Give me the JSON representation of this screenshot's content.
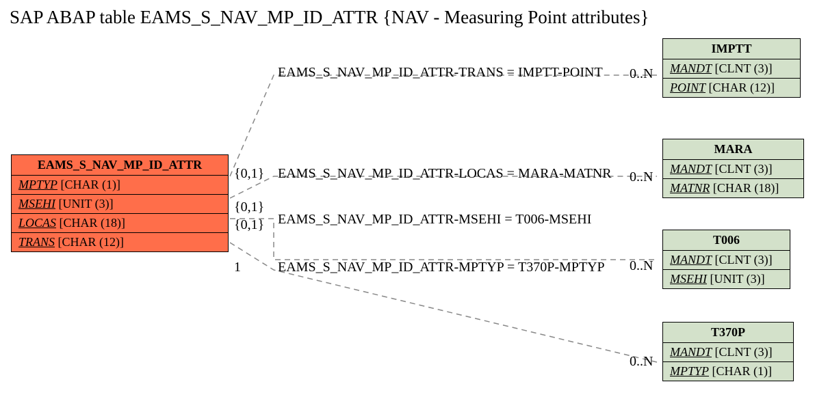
{
  "title": "SAP ABAP table EAMS_S_NAV_MP_ID_ATTR {NAV - Measuring Point attributes}",
  "main": {
    "name": "EAMS_S_NAV_MP_ID_ATTR",
    "fields": [
      {
        "name": "MPTYP",
        "type": "[CHAR (1)]"
      },
      {
        "name": "MSEHI",
        "type": "[UNIT (3)]"
      },
      {
        "name": "LOCAS",
        "type": "[CHAR (18)]"
      },
      {
        "name": "TRANS",
        "type": "[CHAR (12)]"
      }
    ]
  },
  "refs": {
    "imptt": {
      "name": "IMPTT",
      "fields": [
        {
          "name": "MANDT",
          "type": "[CLNT (3)]"
        },
        {
          "name": "POINT",
          "type": "[CHAR (12)]"
        }
      ]
    },
    "mara": {
      "name": "MARA",
      "fields": [
        {
          "name": "MANDT",
          "type": "[CLNT (3)]"
        },
        {
          "name": "MATNR",
          "type": "[CHAR (18)]"
        }
      ]
    },
    "t006": {
      "name": "T006",
      "fields": [
        {
          "name": "MANDT",
          "type": "[CLNT (3)]"
        },
        {
          "name": "MSEHI",
          "type": "[UNIT (3)]"
        }
      ]
    },
    "t370p": {
      "name": "T370P",
      "fields": [
        {
          "name": "MANDT",
          "type": "[CLNT (3)]"
        },
        {
          "name": "MPTYP",
          "type": "[CHAR (1)]"
        }
      ]
    }
  },
  "rels": {
    "r1": {
      "label": "EAMS_S_NAV_MP_ID_ATTR-TRANS = IMPTT-POINT",
      "lcard": "{0,1}",
      "rcard": "0..N"
    },
    "r2": {
      "label": "EAMS_S_NAV_MP_ID_ATTR-LOCAS = MARA-MATNR",
      "lcard": "{0,1}",
      "rcard": "0..N"
    },
    "r3": {
      "label": "EAMS_S_NAV_MP_ID_ATTR-MSEHI = T006-MSEHI",
      "lcard": "{0,1}",
      "rcard": "0..N"
    },
    "r4": {
      "label": "EAMS_S_NAV_MP_ID_ATTR-MPTYP = T370P-MPTYP",
      "lcard": "1",
      "rcard": "0..N"
    }
  }
}
